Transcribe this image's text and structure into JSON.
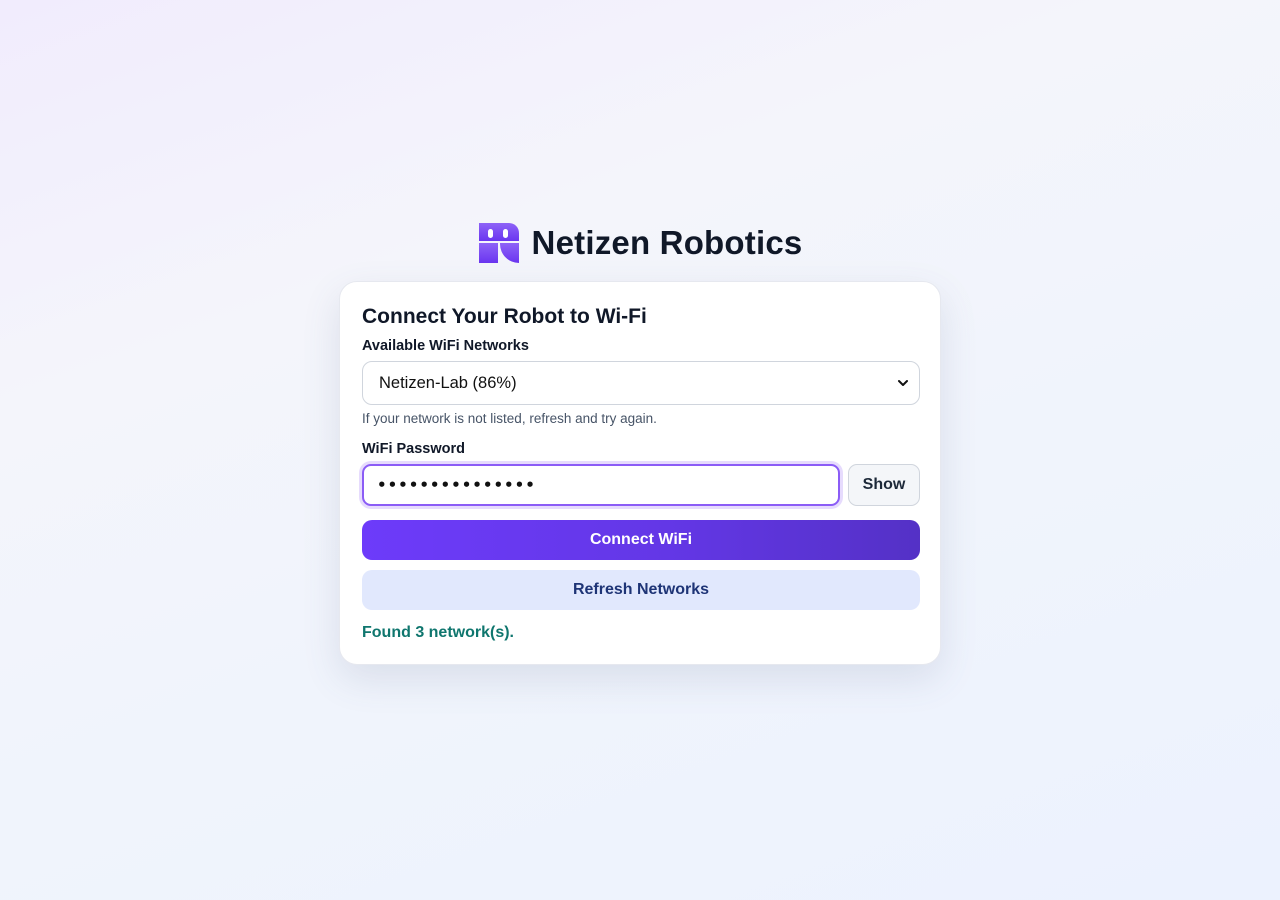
{
  "brand": {
    "name": "Netizen Robotics",
    "logo_icon": "robot-face-logo",
    "logo_colors": [
      "#8b5cf6",
      "#6d3bfa"
    ]
  },
  "card": {
    "title": "Connect Your Robot to Wi-Fi",
    "networks": {
      "label": "Available WiFi Networks",
      "selected": "Netizen-Lab (86%)",
      "hint": "If your network is not listed, refresh and try again."
    },
    "password": {
      "label": "WiFi Password",
      "masked_value": "•••••••••••••••",
      "show_label": "Show"
    },
    "connect_label": "Connect WiFi",
    "refresh_label": "Refresh Networks",
    "status": "Found 3 network(s)."
  },
  "colors": {
    "accent": "#6d3bfa",
    "status_success": "#0f766e",
    "refresh_bg": "#e1e8fd"
  }
}
